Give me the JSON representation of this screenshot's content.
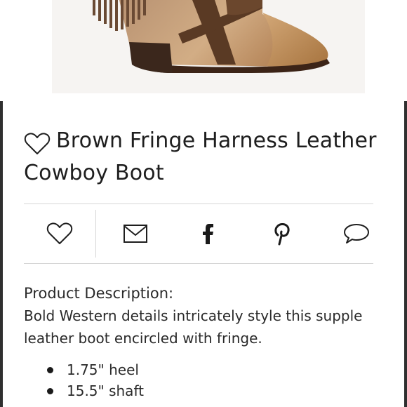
{
  "product": {
    "title": "Brown Fringe Harness Leather Cowboy Boot"
  },
  "share": {
    "icons": [
      "heart-icon",
      "mail-icon",
      "facebook-icon",
      "pinterest-icon",
      "comment-icon"
    ]
  },
  "description": {
    "heading": "Product Description:",
    "body": "Bold Western details intricately style this supple leather boot encircled with fringe.",
    "specs": [
      "1.75\" heel",
      "15.5\" shaft"
    ]
  },
  "colors": {
    "text": "#2a2a2a",
    "divider": "#d6d6d6",
    "leather_light": "#c9a37c",
    "leather_dark": "#5a3a24"
  }
}
